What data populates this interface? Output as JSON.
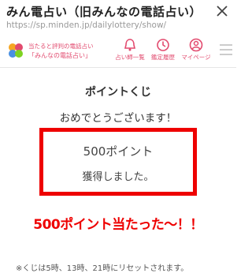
{
  "browser": {
    "title": "みん電占い（旧みんなの電話占い）",
    "url": "https://sp.minden.jp/dailylottery/show/"
  },
  "header": {
    "tagline_line1": "当たると評判の電話占い",
    "tagline_line2": "「みんなの電話占い」",
    "nav": [
      {
        "label": "占い師一覧",
        "icon": "bell-icon"
      },
      {
        "label": "鑑定履歴",
        "icon": "clock-icon"
      },
      {
        "label": "マイページ",
        "icon": "user-icon"
      }
    ],
    "accent_color": "#e24a6e"
  },
  "lottery": {
    "title": "ポイントくじ",
    "message": "おめでとうございます！",
    "points": "500ポイント",
    "acquired": "獲得しました。"
  },
  "annotation": "500ポイント当たった〜！！",
  "footnote": "※くじは5時、13時、21時にリセットされます。",
  "colors": {
    "highlight": "#ee0000"
  }
}
